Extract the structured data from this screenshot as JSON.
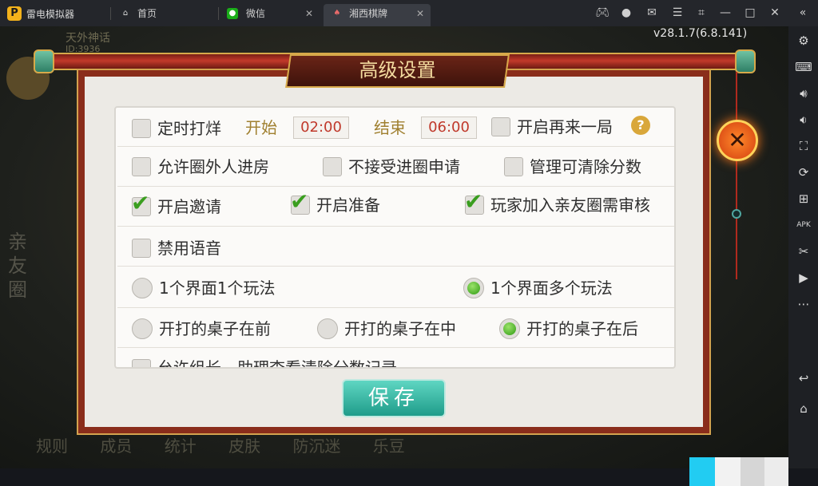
{
  "titlebar": {
    "app_name": "雷电模拟器",
    "tabs": [
      {
        "label": "首页",
        "icon": "home-icon"
      },
      {
        "label": "微信",
        "icon": "wechat-icon"
      },
      {
        "label": "湘西棋牌",
        "icon": "game-app-icon"
      }
    ],
    "version": "v28.1.7(6.8.141)"
  },
  "background": {
    "player_name": "天外神话",
    "player_id": "ID:3936",
    "side_label": "亲友圈",
    "bottom_nav": [
      "规则",
      "成员",
      "统计",
      "皮肤",
      "防沉迷",
      "乐豆"
    ]
  },
  "dialog": {
    "title": "高级设置",
    "rows": {
      "timed_close": {
        "label": "定时打烊",
        "start_label": "开始",
        "start_value": "02:00",
        "end_label": "结束",
        "end_value": "06:00",
        "checked": false
      },
      "replay": {
        "label": "开启再来一局",
        "checked": false
      },
      "allow_outsiders": {
        "label": "允许圈外人进房",
        "checked": false
      },
      "reject_join": {
        "label": "不接受进圈申请",
        "checked": false
      },
      "admin_clear": {
        "label": "管理可清除分数",
        "checked": false
      },
      "enable_invite": {
        "label": "开启邀请",
        "checked": true
      },
      "enable_ready": {
        "label": "开启准备",
        "checked": true
      },
      "join_review": {
        "label": "玩家加入亲友圈需审核",
        "checked": true
      },
      "disable_voice": {
        "label": "禁用语音",
        "checked": false
      },
      "one_mode": {
        "label": "1个界面1个玩法",
        "selected": false
      },
      "multi_mode": {
        "label": "1个界面多个玩法",
        "selected": true
      },
      "tables_front": {
        "label": "开打的桌子在前",
        "selected": false
      },
      "tables_middle": {
        "label": "开打的桌子在中",
        "selected": false
      },
      "tables_back": {
        "label": "开打的桌子在后",
        "selected": true
      },
      "partial_row": {
        "label": "允许组长、助理查看清除分数记录"
      }
    },
    "save_label": "保存",
    "close_symbol": "✕"
  }
}
